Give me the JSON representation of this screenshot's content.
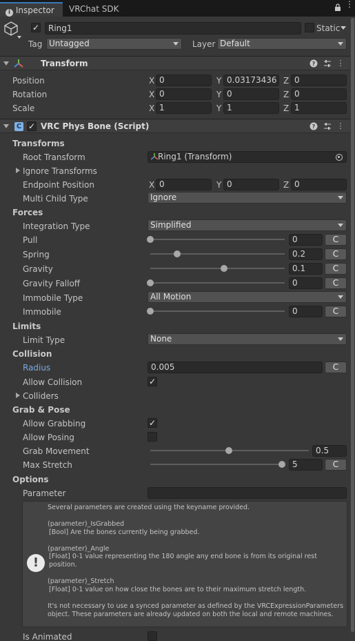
{
  "tabs": [
    {
      "label": "Inspector",
      "icon": "info-icon"
    },
    {
      "label": "VRChat SDK"
    }
  ],
  "object": {
    "name": "Ring1",
    "active": true,
    "static_label": "Static",
    "static": false,
    "tag_label": "Tag",
    "tag_value": "Untagged",
    "layer_label": "Layer",
    "layer_value": "Default"
  },
  "transform": {
    "title": "Transform",
    "rows": [
      {
        "label": "Position",
        "x": "0",
        "y": "0.03173436",
        "z": "0"
      },
      {
        "label": "Rotation",
        "x": "0",
        "y": "0",
        "z": "0"
      },
      {
        "label": "Scale",
        "x": "1",
        "y": "1",
        "z": "1"
      }
    ],
    "axes": {
      "x": "X",
      "y": "Y",
      "z": "Z"
    }
  },
  "physbone": {
    "title": "VRC Phys Bone (Script)",
    "enabled": true,
    "sections": {
      "transforms": "Transforms",
      "forces": "Forces",
      "limits": "Limits",
      "collision": "Collision",
      "grab_pose": "Grab & Pose",
      "options": "Options"
    },
    "root_transform_label": "Root Transform",
    "root_transform_value": "Ring1 (Transform)",
    "ignore_transforms_label": "Ignore Transforms",
    "endpoint_label": "Endpoint Position",
    "endpoint": {
      "x": "0",
      "y": "0",
      "z": "0"
    },
    "multi_child_label": "Multi Child Type",
    "multi_child_value": "Ignore",
    "integration_label": "Integration Type",
    "integration_value": "Simplified",
    "sliders": {
      "pull": {
        "label": "Pull",
        "value": "0",
        "fraction": 0.0
      },
      "spring": {
        "label": "Spring",
        "value": "0.2",
        "fraction": 0.2
      },
      "gravity": {
        "label": "Gravity",
        "value": "0.1",
        "fraction": 0.55
      },
      "gravity_falloff": {
        "label": "Gravity Falloff",
        "value": "0",
        "fraction": 0.0
      },
      "immobile": {
        "label": "Immobile",
        "value": "0",
        "fraction": 0.0
      },
      "grab_movement": {
        "label": "Grab Movement",
        "value": "0.5",
        "fraction": 0.5
      },
      "max_stretch": {
        "label": "Max Stretch",
        "value": "5",
        "fraction": 1.0
      }
    },
    "curve_button": "C",
    "immobile_type_label": "Immobile Type",
    "immobile_type_value": "All Motion",
    "limit_type_label": "Limit Type",
    "limit_type_value": "None",
    "radius_label": "Radius",
    "radius_value": "0.005",
    "allow_collision_label": "Allow Collision",
    "allow_collision": true,
    "colliders_label": "Colliders",
    "allow_grabbing_label": "Allow Grabbing",
    "allow_grabbing": true,
    "allow_posing_label": "Allow Posing",
    "allow_posing": false,
    "parameter_label": "Parameter",
    "parameter_value": "",
    "help": {
      "intro": "Several parameters are created using the keyname provided.",
      "isgrabbed_name": "(parameter)_IsGrabbed",
      "isgrabbed_desc": "[Bool] Are the bones currently being grabbed.",
      "angle_name": "(parameter)_Angle",
      "angle_desc": "[Float] 0-1 value representing the 180 angle any end bone is from its original rest position.",
      "stretch_name": "(parameter)_Stretch",
      "stretch_desc": "[Float] 0-1 value on how close the bones are to their maximum stretch length.",
      "note": "It's not necessary to use a synced parameter as defined by the VRCExpressionParameters object.  These parameters are already updated on both the local and remote machines."
    },
    "is_animated_label": "Is Animated",
    "is_animated": false
  },
  "colors": {
    "background": "#383838",
    "accent": "#3a79bb",
    "radius_label": "#7ba9e0"
  }
}
